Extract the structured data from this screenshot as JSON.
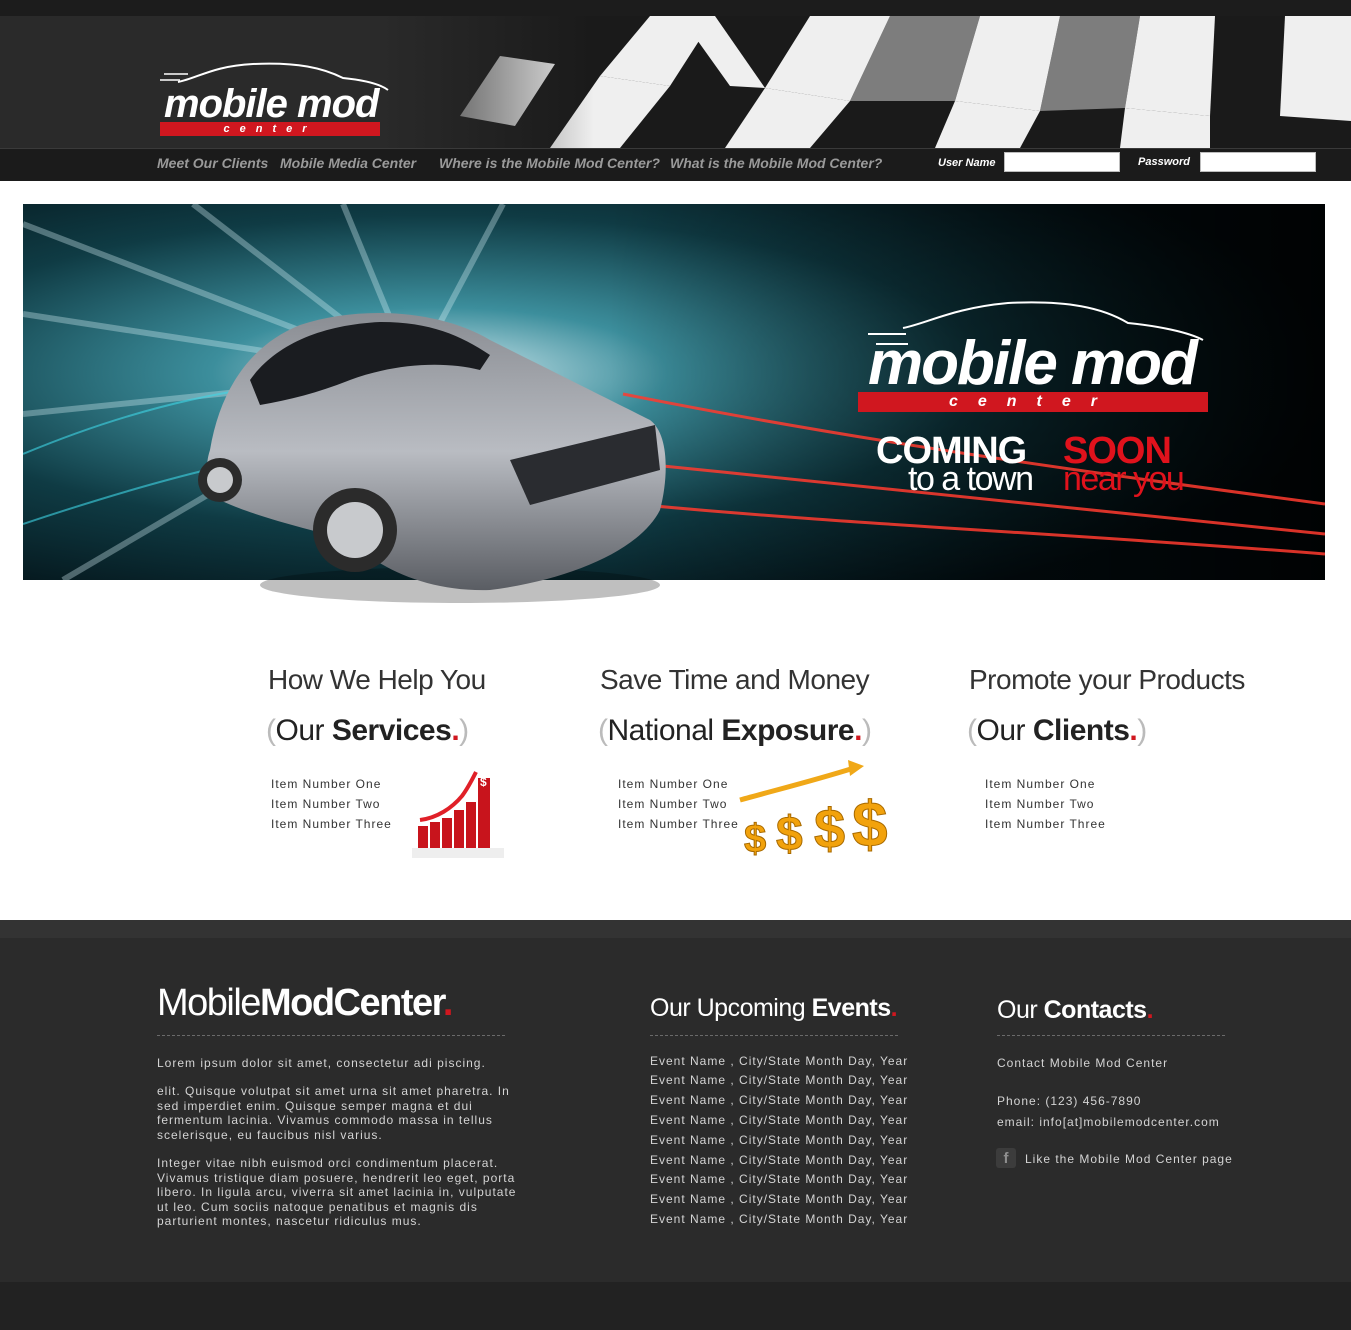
{
  "header": {
    "logo": {
      "brand": "mobile mod",
      "sub": "center"
    },
    "nav": [
      "Meet Our Clients",
      "Mobile Media Center",
      "Where is the Mobile Mod Center?",
      "What is the Mobile Mod Center?"
    ],
    "login": {
      "username_label": "User Name",
      "password_label": "Password",
      "username_value": "",
      "password_value": ""
    }
  },
  "banner": {
    "logo": {
      "brand": "mobile mod",
      "sub": "center"
    },
    "headline": {
      "word1": "COMING",
      "word2": "SOON",
      "line2a": "to a town",
      "line2b": "near you"
    }
  },
  "features": [
    {
      "title": "How We Help You",
      "sub_open": "(",
      "sub_plain": "Our ",
      "sub_bold": "Services",
      "sub_dot": ".",
      "sub_close": ")",
      "items": [
        "Item Number One",
        "Item Number Two",
        "Item Number Three"
      ],
      "image_icon": "growth-chart-icon"
    },
    {
      "title": "Save Time and Money",
      "sub_open": "(",
      "sub_plain": "National ",
      "sub_bold": "Exposure",
      "sub_dot": ".",
      "sub_close": ")",
      "items": [
        "Item Number One",
        "Item Number Two",
        "Item Number Three"
      ],
      "image_icon": "dollar-signs-icon"
    },
    {
      "title": "Promote your Products",
      "sub_open": "(",
      "sub_plain": "Our ",
      "sub_bold": "Clients",
      "sub_dot": ".",
      "sub_close": ")",
      "items": [
        "Item Number One",
        "Item Number Two",
        "Item Number Three"
      ]
    }
  ],
  "footer": {
    "about": {
      "head_plain": "Mobile",
      "head_bold": "ModCenter",
      "head_dot": ".",
      "paragraphs": [
        "Lorem ipsum dolor sit amet, consectetur adi piscing.",
        "elit. Quisque volutpat sit amet urna sit amet pharetra. In sed imperdiet enim. Quisque semper magna et dui fermentum lacinia. Vivamus commodo massa in tellus scelerisque, eu faucibus nisl varius.",
        "Integer vitae nibh euismod orci condimentum placerat. Vivamus tristique diam posuere, hendrerit leo eget, porta libero. In ligula arcu, viverra sit amet lacinia in, vulputate ut leo. Cum sociis natoque penatibus et magnis dis parturient montes, nascetur ridiculus mus."
      ]
    },
    "events": {
      "head_plain": "Our Upcoming ",
      "head_bold": "Events",
      "head_dot": ".",
      "rows": [
        "Event Name , City/State  Month Day, Year",
        "Event Name , City/State  Month Day, Year",
        "Event Name , City/State  Month Day, Year",
        "Event Name , City/State  Month Day, Year",
        "Event Name , City/State  Month Day, Year",
        "Event Name , City/State  Month Day, Year",
        "Event Name , City/State  Month Day, Year",
        "Event Name , City/State  Month Day, Year",
        "Event Name , City/State  Month Day, Year"
      ]
    },
    "contacts": {
      "head_plain": "Our ",
      "head_bold": "Contacts",
      "head_dot": ".",
      "company": "Contact Mobile Mod Center",
      "phone": "Phone: (123) 456-7890",
      "email": "email: info[at]mobilemodcenter.com",
      "facebook_label": "Like the Mobile Mod Center page",
      "facebook_icon_glyph": "f",
      "facebook_icon": "facebook-icon"
    }
  },
  "colors": {
    "accent_red": "#d0171f",
    "header_bg": "#2a2a2a",
    "footer_bg": "#2b2b2b",
    "nav_text": "#9a9a9a"
  }
}
